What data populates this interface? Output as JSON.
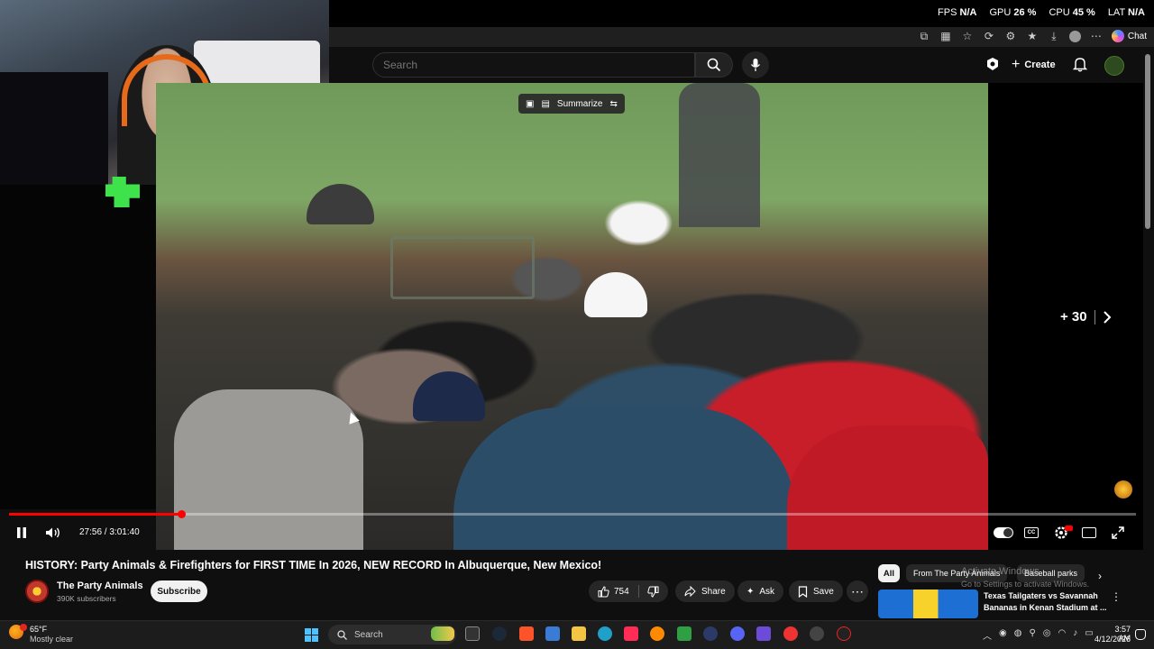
{
  "perf_overlay": {
    "fps_label": "FPS",
    "fps_value": "N/A",
    "gpu_label": "GPU",
    "gpu_value": "26 %",
    "cpu_label": "CPU",
    "cpu_value": "45 %",
    "lat_label": "LAT",
    "lat_value": "N/A"
  },
  "browser": {
    "chat_label": "Chat"
  },
  "youtube_header": {
    "search_placeholder": "Search",
    "create_label": "Create"
  },
  "player": {
    "summarize_label": "Summarize",
    "skip_label": "+ 30",
    "current_time": "27:56",
    "duration": "3:01:40",
    "time_separator": " / ",
    "progress_fraction": 0.153
  },
  "video_info": {
    "title": "HISTORY: Party Animals & Firefighters for FIRST TIME In 2026, NEW RECORD In Albuquerque, New Mexico!",
    "channel_name": "The Party Animals",
    "subscribers": "390K subscribers",
    "subscribe_label": "Subscribe",
    "like_count": "754",
    "share_label": "Share",
    "ask_label": "Ask",
    "save_label": "Save"
  },
  "sidebar": {
    "chips": [
      "All",
      "From The Party Animals",
      "Baseball parks"
    ],
    "watermark_title": "Activate Windows",
    "watermark_sub": "Go to Settings to activate Windows.",
    "recommended_title": "Texas Tailgaters vs Savannah Bananas in Kenan Stadium at ..."
  },
  "taskbar": {
    "weather_temp": "65°F",
    "weather_desc": "Mostly clear",
    "search_label": "Search",
    "time": "3:57 AM",
    "date": "4/12/2026"
  },
  "colors": {
    "accent_red": "#ff0000",
    "background": "#0f0f0f",
    "pill_bg": "#272727"
  }
}
